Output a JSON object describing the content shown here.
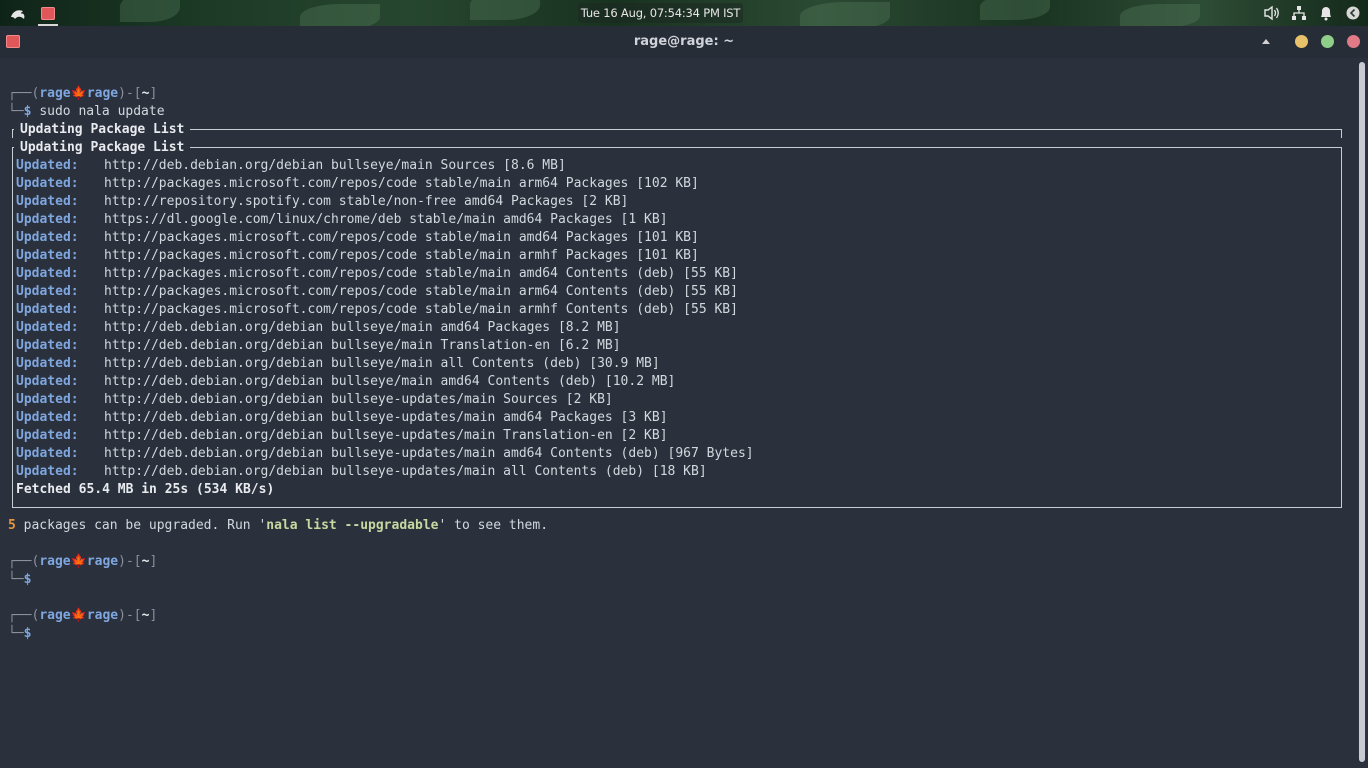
{
  "topbar": {
    "clock": "Tue 16 Aug, 07:54:34 PM IST",
    "icons": [
      "kali-dragon-icon",
      "terminal-app-icon",
      "volume-icon",
      "network-icon",
      "notification-bell-icon",
      "power-icon"
    ]
  },
  "window": {
    "title": "rage@rage: ~",
    "controls": {
      "minimize_color": "#e8c26a",
      "maximize_color": "#8fcf8a",
      "close_color": "#e07a86"
    }
  },
  "prompt": {
    "user": "rage",
    "host": "rage",
    "dir": "~",
    "leaf": "🍁"
  },
  "terminal": {
    "command": "sudo nala update",
    "box_title": "Updating Package List",
    "updated_label": "Updated:",
    "updates": [
      "http://deb.debian.org/debian bullseye/main Sources [8.6 MB]",
      "http://packages.microsoft.com/repos/code stable/main arm64 Packages [102 KB]",
      "http://repository.spotify.com stable/non-free amd64 Packages [2 KB]",
      "https://dl.google.com/linux/chrome/deb stable/main amd64 Packages [1 KB]",
      "http://packages.microsoft.com/repos/code stable/main amd64 Packages [101 KB]",
      "http://packages.microsoft.com/repos/code stable/main armhf Packages [101 KB]",
      "http://packages.microsoft.com/repos/code stable/main amd64 Contents (deb) [55 KB]",
      "http://packages.microsoft.com/repos/code stable/main arm64 Contents (deb) [55 KB]",
      "http://packages.microsoft.com/repos/code stable/main armhf Contents (deb) [55 KB]",
      "http://deb.debian.org/debian bullseye/main amd64 Packages [8.2 MB]",
      "http://deb.debian.org/debian bullseye/main Translation-en [6.2 MB]",
      "http://deb.debian.org/debian bullseye/main all Contents (deb) [30.9 MB]",
      "http://deb.debian.org/debian bullseye/main amd64 Contents (deb) [10.2 MB]",
      "http://deb.debian.org/debian bullseye-updates/main Sources [2 KB]",
      "http://deb.debian.org/debian bullseye-updates/main amd64 Packages [3 KB]",
      "http://deb.debian.org/debian bullseye-updates/main Translation-en [2 KB]",
      "http://deb.debian.org/debian bullseye-updates/main amd64 Contents (deb) [967 Bytes]",
      "http://deb.debian.org/debian bullseye-updates/main all Contents (deb) [18 KB]"
    ],
    "fetched": "Fetched 65.4 MB in 25s (534 KB/s)",
    "upgrade_count": "5",
    "upgrade_text_1": " packages can be upgraded. Run '",
    "upgrade_cmd": "nala list --upgradable",
    "upgrade_text_2": "' to see them."
  }
}
